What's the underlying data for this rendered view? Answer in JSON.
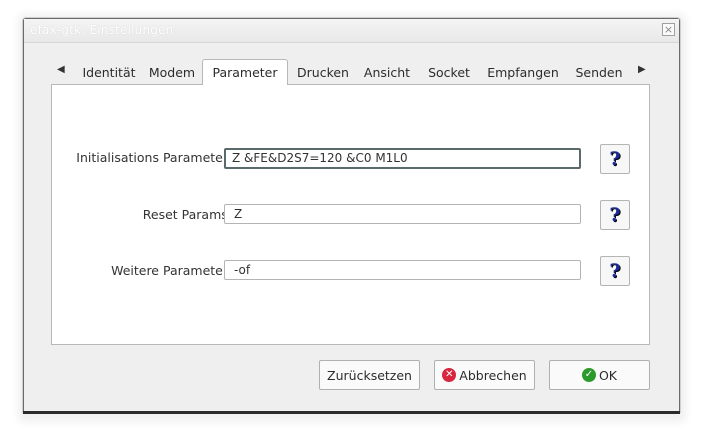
{
  "window": {
    "title": "efax-gtk: Einstellungen",
    "close_glyph": "×"
  },
  "tabs": {
    "left_arrow": "◀",
    "right_arrow": "▶",
    "items": [
      {
        "label": "Identität"
      },
      {
        "label": "Modem"
      },
      {
        "label": "Parameter",
        "active": true
      },
      {
        "label": "Drucken"
      },
      {
        "label": "Ansicht"
      },
      {
        "label": "Socket"
      },
      {
        "label": "Empfangen"
      },
      {
        "label": "Senden"
      }
    ]
  },
  "params": {
    "init": {
      "label": "Initialisations Parameter:",
      "value": "Z &FE&D2S7=120 &C0 M1L0"
    },
    "reset": {
      "label": "Reset Params:",
      "value": "Z"
    },
    "further": {
      "label": "Weitere Parameter:",
      "value": "-of"
    },
    "help_glyph": "?"
  },
  "buttons": {
    "reset_label": "Zurücksetzen",
    "cancel_label": "Abbrechen",
    "ok_label": "OK",
    "cancel_glyph": "✕",
    "ok_glyph": "✓"
  }
}
